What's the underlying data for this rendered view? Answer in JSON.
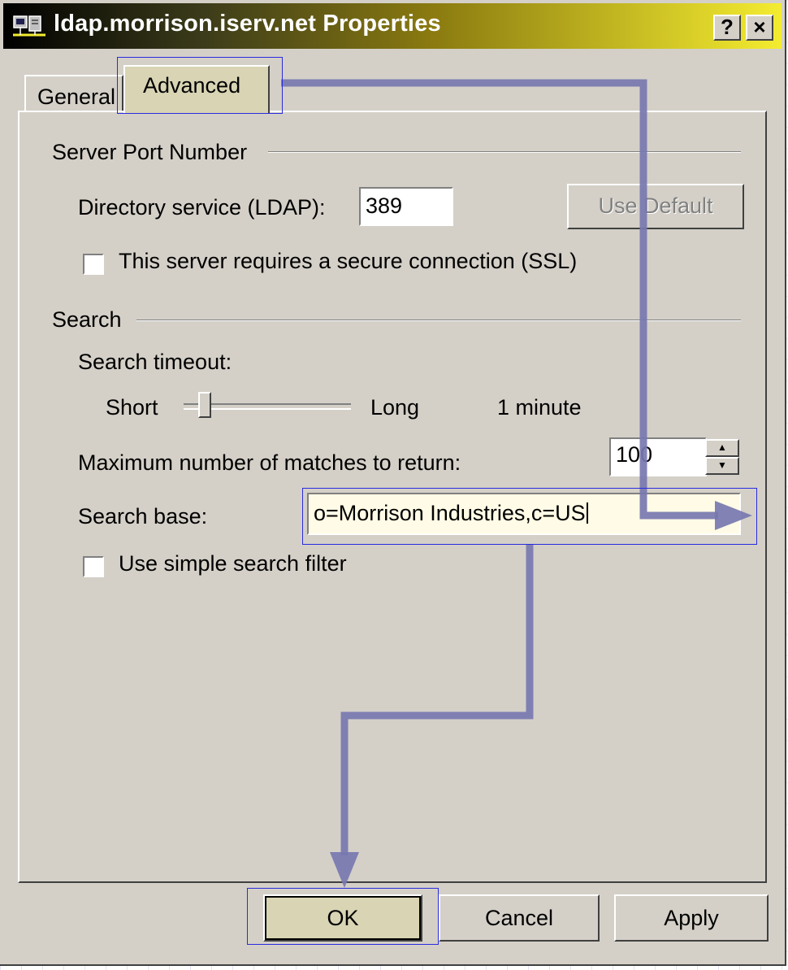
{
  "window": {
    "title": "ldap.morrison.iserv.net Properties",
    "help_button": "?",
    "close_button": "×"
  },
  "tabs": [
    {
      "label": "General",
      "selected": false
    },
    {
      "label": "Advanced",
      "selected": true
    }
  ],
  "server_port": {
    "group_label": "Server Port Number",
    "ldap_label": "Directory service (LDAP):",
    "ldap_value": "389",
    "use_default_label": "Use Default",
    "ssl_label": "This server requires a secure connection (SSL)",
    "ssl_checked": false
  },
  "search": {
    "group_label": "Search",
    "timeout_label": "Search timeout:",
    "slider_min_label": "Short",
    "slider_max_label": "Long",
    "timeout_value": "1 minute",
    "max_matches_label": "Maximum number of matches to return:",
    "max_matches_value": "100",
    "search_base_label": "Search base:",
    "search_base_value": "o=Morrison Industries,c=US",
    "simple_filter_label": "Use simple search filter",
    "simple_filter_checked": false
  },
  "buttons": {
    "ok": "OK",
    "cancel": "Cancel",
    "apply": "Apply"
  },
  "colors": {
    "dialog_bg": "#d4d0c8",
    "annotation_arrow": "#7777b0",
    "highlight_border": "#2a2ae0",
    "highlight_fill": "#d8d4b4"
  }
}
